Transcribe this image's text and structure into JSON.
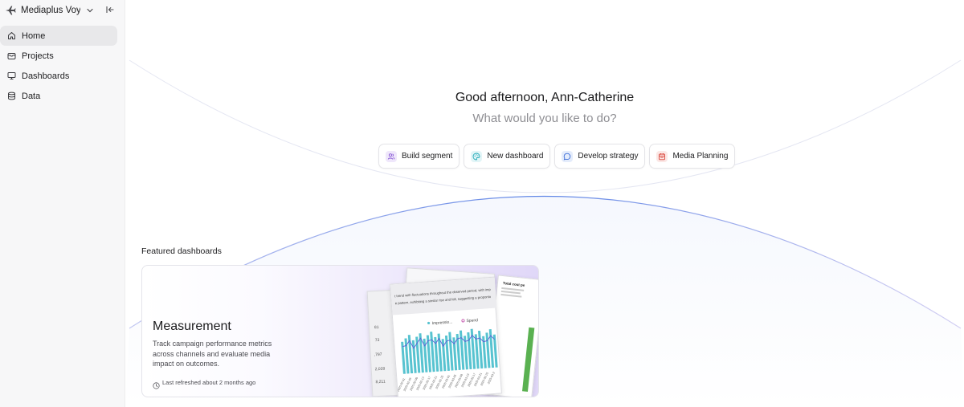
{
  "sidebar": {
    "workspace": {
      "name": "Mediaplus Voya...",
      "icon": "plane-icon"
    },
    "items": [
      {
        "label": "Home",
        "icon": "home-icon",
        "active": true
      },
      {
        "label": "Projects",
        "icon": "folder-icon",
        "active": false
      },
      {
        "label": "Dashboards",
        "icon": "monitor-icon",
        "active": false
      },
      {
        "label": "Data",
        "icon": "database-icon",
        "active": false
      }
    ]
  },
  "main": {
    "greeting": "Good afternoon, Ann-Catherine",
    "subgreeting": "What would you like to do?",
    "actions": [
      {
        "label": "Build segment",
        "icon": "users-icon",
        "color": "#8a5cd6",
        "bg": "#efe7fb"
      },
      {
        "label": "New dashboard",
        "icon": "palette-icon",
        "color": "#1fa9b8",
        "bg": "#e2f5f7"
      },
      {
        "label": "Develop strategy",
        "icon": "chat-icon",
        "color": "#3f6fd8",
        "bg": "#e4ecfb"
      },
      {
        "label": "Media Planning",
        "icon": "calendar-icon",
        "color": "#d9463b",
        "bg": "#fbe7e5"
      }
    ],
    "featured_title": "Featured dashboards",
    "card": {
      "title": "Measurement",
      "description": "Track campaign performance metrics across channels and evaluate media impact on outcomes.",
      "meta": "Last refreshed about 2 months ago",
      "preview": {
        "text_line1": "t trend with fluctuations throughout the observed period, with imp",
        "text_line2": "e pattern, exhibiting a similar rise and fall, suggesting a proportio",
        "legend_a": "Impressio...",
        "legend_b": "Spend",
        "side_label": "Total cost pe",
        "y_ticks": [
          "81",
          "73",
          ",797",
          "2,028",
          "8,211"
        ],
        "x_ticks": [
          "2025-02-01",
          "2025-02-05",
          "2025-02-09",
          "2025-02-13",
          "2025-02-17",
          "2025-02-21",
          "2025-02-25",
          "2025-03-01",
          "2025-03-05",
          "2025-03-09",
          "2025-03-13",
          "2025-03-17",
          "2025-03-21",
          "2025-03-25",
          "2025-03-2"
        ],
        "bar_color": "#57c3d0",
        "line_color": "#5b5fd6"
      }
    }
  }
}
